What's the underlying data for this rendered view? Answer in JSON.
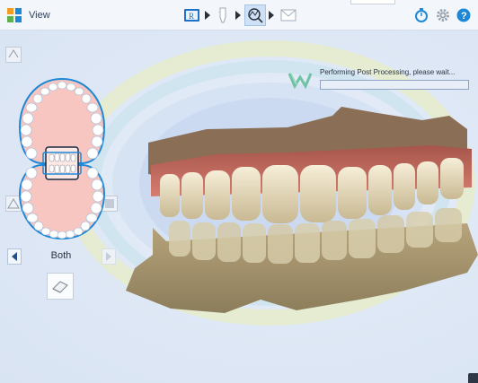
{
  "header": {
    "title": "View",
    "workflow": [
      {
        "name": "rx-step",
        "active": false
      },
      {
        "name": "scan-step",
        "active": false
      },
      {
        "name": "view-step",
        "active": true
      },
      {
        "name": "send-step",
        "active": false
      }
    ],
    "right_icons": [
      "timer-icon",
      "gear-icon",
      "help-icon"
    ]
  },
  "left_panel": {
    "jaw_label": "Both",
    "arch_icon": "dental-arch-icon",
    "prev_icon": "triangle-left-icon",
    "next_icon": "triangle-right-icon",
    "tool_icon": "eraser-icon"
  },
  "status": {
    "message": "Performing Post Processing, please wait...",
    "progress": 0.0
  },
  "colors": {
    "accent": "#1e88d8",
    "gum": "#c96b60",
    "tooth": "#efe6cf",
    "base": "#9a8a66"
  }
}
